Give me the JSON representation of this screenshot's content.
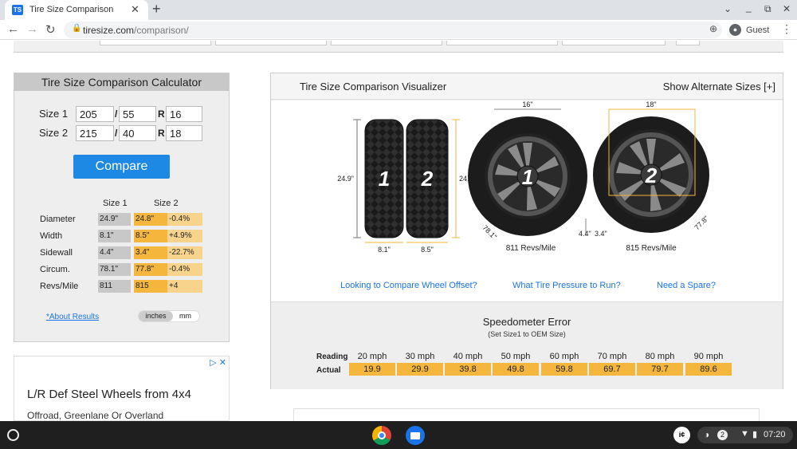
{
  "browser": {
    "tab_title": "Tire Size Comparison",
    "favicon_text": "TS",
    "tab_close": "✕",
    "new_tab": "+",
    "url_domain": "tiresize.com",
    "url_path": "/comparison/",
    "profile_label": "Guest",
    "window_controls": {
      "chevron": "⌄",
      "minimize": "_",
      "restore": "⧉",
      "close": "✕"
    }
  },
  "calculator": {
    "title": "Tire Size Comparison Calculator",
    "size1_label": "Size 1",
    "size2_label": "Size 2",
    "size1": {
      "width": "205",
      "aspect": "55",
      "rim": "16"
    },
    "size2": {
      "width": "215",
      "aspect": "40",
      "rim": "18"
    },
    "slash": "/",
    "r": "R",
    "compare_button": "Compare",
    "col_size1": "Size 1",
    "col_size2": "Size 2",
    "rows": [
      {
        "label": "Diameter",
        "s1": "24.9\"",
        "s2": "24.8\"",
        "diff": "-0.4%"
      },
      {
        "label": "Width",
        "s1": "8.1\"",
        "s2": "8.5\"",
        "diff": "+4.9%"
      },
      {
        "label": "Sidewall",
        "s1": "4.4\"",
        "s2": "3.4\"",
        "diff": "-22.7%"
      },
      {
        "label": "Circum.",
        "s1": "78.1\"",
        "s2": "77.8\"",
        "diff": "-0.4%"
      },
      {
        "label": "Revs/Mile",
        "s1": "811",
        "s2": "815",
        "diff": "+4"
      }
    ],
    "about_link": "*About Results",
    "unit_inches": "inches",
    "unit_mm": "mm"
  },
  "ad": {
    "headline": "L/R Def Steel Wheels from 4x4",
    "subline": "Offroad, Greenlane Or Overland",
    "icons": "▷ ✕"
  },
  "visualizer": {
    "title": "Tire Size Comparison Visualizer",
    "alt_sizes": "Show Alternate Sizes [+]",
    "tire1_diameter": "24.9\"",
    "tire2_diameter": "24.8\"",
    "tire1_width": "8.1\"",
    "tire2_width": "8.5\"",
    "tire1_num": "1",
    "tire2_num": "2",
    "wheel1_rim": "16\"",
    "wheel2_rim": "18\"",
    "wheel1_sidewall": "4.4\"",
    "wheel2_sidewall": "3.4\"",
    "wheel1_circ": "78.1\"",
    "wheel2_circ": "77.8\"",
    "wheel1_revs": "811 Revs/Mile",
    "wheel2_revs": "815 Revs/Mile",
    "links": [
      "Looking to Compare Wheel Offset?",
      "What Tire Pressure to Run?",
      "Need a Spare?"
    ]
  },
  "speedometer": {
    "title": "Speedometer Error",
    "subtitle": "(Set Size1 to OEM Size)",
    "reading_label": "Reading",
    "actual_label": "Actual",
    "reading": [
      "20 mph",
      "30 mph",
      "40 mph",
      "50 mph",
      "60 mph",
      "70 mph",
      "80 mph",
      "90 mph"
    ],
    "actual": [
      "19.9",
      "29.9",
      "39.8",
      "49.8",
      "59.8",
      "69.7",
      "79.7",
      "89.6"
    ]
  },
  "taskbar": {
    "clock": "07:20",
    "notification_count": "2",
    "ime_label": "i¢"
  },
  "colors": {
    "accent": "#1e88e5",
    "highlight": "#f4b63c",
    "highlight_light": "#f8d38c",
    "link": "#1a73e8"
  }
}
